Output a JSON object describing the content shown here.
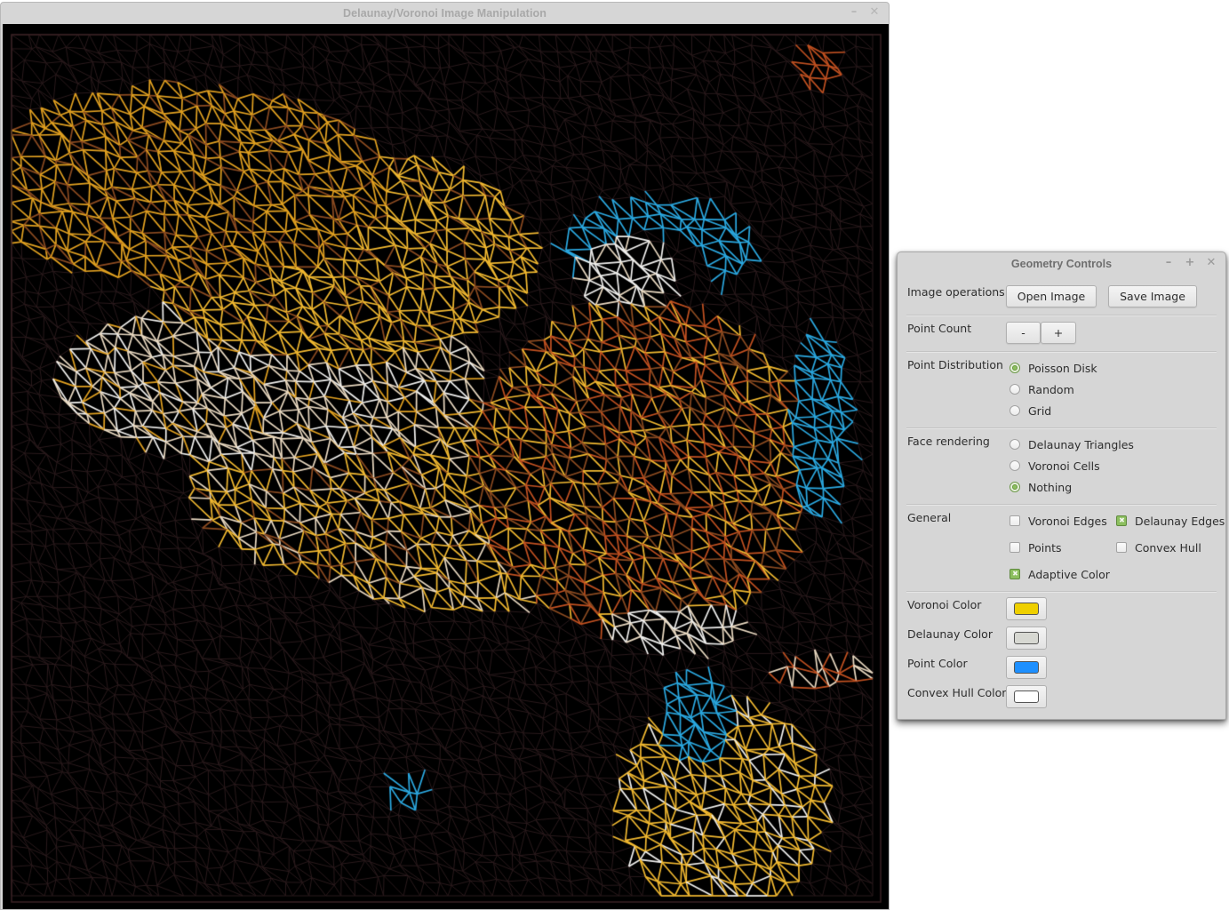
{
  "main_window": {
    "title": "Delaunay/Voronoi Image Manipulation",
    "controls": {
      "minimize_icon": "–",
      "close_icon": "✕"
    },
    "canvas": {
      "description": "Parrot image rendered as Delaunay triangle edges with adaptive color on black background",
      "background": "#000000",
      "palette": {
        "dark_edge": "#2a1a1c",
        "orange": "#e0a020",
        "gold": "#f0b830",
        "cream": "#e8d8c0",
        "white": "#f0f0ee",
        "blue": "#2aa8e0",
        "rust": "#c05020",
        "brown": "#8a4a20",
        "green": "#5a9a20"
      }
    }
  },
  "controls_window": {
    "title": "Geometry Controls",
    "title_buttons": {
      "minimize_icon": "–",
      "maximize_icon": "+",
      "close_icon": "✕"
    },
    "image_operations": {
      "label": "Image operations",
      "open_button": "Open Image",
      "save_button": "Save Image"
    },
    "point_count": {
      "label": "Point Count",
      "decrease_button": "-",
      "increase_button": "+"
    },
    "point_distribution": {
      "label": "Point Distribution",
      "options": [
        {
          "label": "Poisson Disk",
          "selected": true
        },
        {
          "label": "Random",
          "selected": false
        },
        {
          "label": "Grid",
          "selected": false
        }
      ]
    },
    "face_rendering": {
      "label": "Face rendering",
      "options": [
        {
          "label": "Delaunay Triangles",
          "selected": false
        },
        {
          "label": "Voronoi Cells",
          "selected": false
        },
        {
          "label": "Nothing",
          "selected": true
        }
      ]
    },
    "general": {
      "label": "General",
      "checkboxes": [
        {
          "label": "Voronoi Edges",
          "checked": false
        },
        {
          "label": "Delaunay Edges",
          "checked": true
        },
        {
          "label": "Points",
          "checked": false
        },
        {
          "label": "Convex Hull",
          "checked": false
        },
        {
          "label": "Adaptive Color",
          "checked": true
        }
      ]
    },
    "colors": [
      {
        "label": "Voronoi Color",
        "value": "#efd000"
      },
      {
        "label": "Delaunay Color",
        "value": "#d7d8d2"
      },
      {
        "label": "Point Color",
        "value": "#1e90ff"
      },
      {
        "label": "Convex Hull Color",
        "value": "#ffffff"
      }
    ]
  }
}
